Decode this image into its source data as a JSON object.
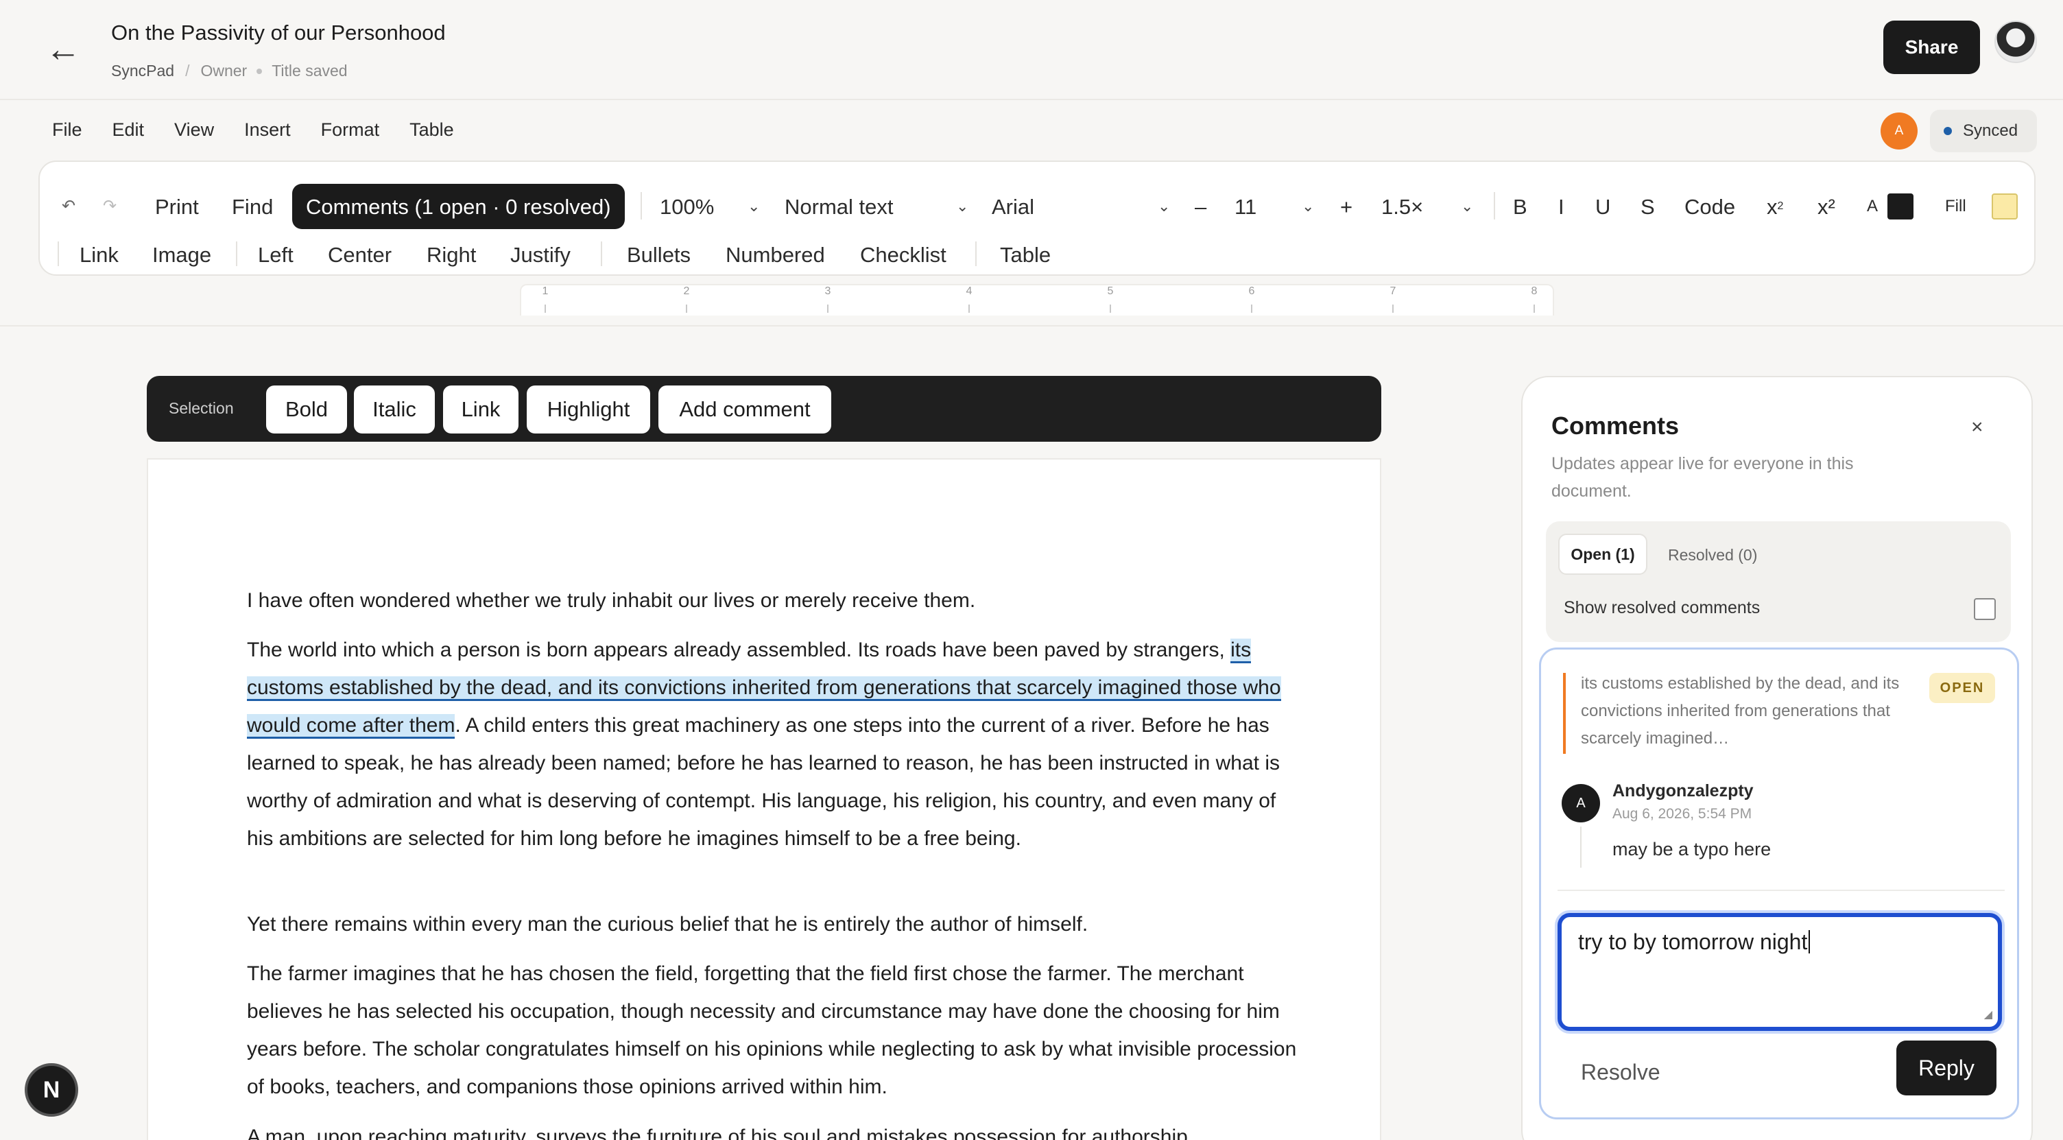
{
  "header": {
    "back_icon": "arrow-left-icon",
    "title": "On the Passivity of our Personhood",
    "app_name": "SyncPad",
    "role": "Owner",
    "status": "Title saved",
    "share_label": "Share"
  },
  "menu": [
    "File",
    "Edit",
    "View",
    "Insert",
    "Format",
    "Table"
  ],
  "presence": {
    "initial": "A",
    "color": "#f07a22"
  },
  "sync": {
    "label": "Synced",
    "dot_color": "#1e5fa8"
  },
  "toolbar": {
    "undo_icon": "undo-icon",
    "redo_icon": "redo-icon",
    "print": "Print",
    "find": "Find",
    "comments": "Comments (1 open · 0 resolved)",
    "zoom": "100%",
    "style": "Normal text",
    "font": "Arial",
    "minus": "–",
    "font_size": "11",
    "plus": "+",
    "line_spacing": "1.5×",
    "bold": "B",
    "italic": "I",
    "underline": "U",
    "strike": "S",
    "code": "Code",
    "subscript": "x",
    "subscript_sub": "2",
    "superscript": "x²",
    "text_color_label": "A",
    "text_color": "#1b1b1b",
    "fill_label": "Fill",
    "fill_color": "#fbeaa6",
    "link": "Link",
    "image": "Image",
    "left": "Left",
    "center": "Center",
    "right": "Right",
    "justify": "Justify",
    "bullets": "Bullets",
    "numbered": "Numbered",
    "checklist": "Checklist",
    "table": "Table"
  },
  "ruler": [
    "1",
    "2",
    "3",
    "4",
    "5",
    "6",
    "7",
    "8"
  ],
  "selection_bar": {
    "label": "Selection",
    "bold": "Bold",
    "italic": "Italic",
    "link": "Link",
    "highlight": "Highlight",
    "add_comment": "Add comment"
  },
  "document": {
    "p1": "I have often wondered whether we truly inhabit our lives or merely receive them.",
    "p2_before": "The world into which a person is born appears already assembled. Its roads have been paved by strangers, ",
    "p2_highlight": "its customs established by the dead, and its convictions inherited from generations that scarcely imagined those who would come after them",
    "p2_after": ". A child enters this great machinery as one steps into the current of a river. Before he has learned to speak, he has already been named; before he has learned to reason, he has been instructed in what is worthy of admiration and what is deserving of contempt. His language, his religion, his country, and even many of his ambitions are selected for him long before he imagines himself to be a free being.",
    "p3": "Yet there remains within every man the curious belief that he is entirely the author of himself.",
    "p4": "The farmer imagines that he has chosen the field, forgetting that the field first chose the farmer. The merchant believes he has selected his occupation, though necessity and circumstance may have done the choosing for him years before. The scholar congratulates himself on his opinions while neglecting to ask by what invisible procession of books, teachers, and companions those opinions arrived within him.",
    "p5": "A man, upon reaching maturity, surveys the furniture of his soul and mistakes possession for authorship."
  },
  "comments_panel": {
    "title": "Comments",
    "close": "×",
    "subtitle": "Updates appear live for everyone in this document.",
    "tab_open": "Open (1)",
    "tab_resolved": "Resolved (0)",
    "show_resolved": "Show resolved comments",
    "thread": {
      "quote": "its customs established by the dead, and its convictions inherited from generations that scarcely imagined…",
      "status": "OPEN",
      "author_initial": "A",
      "author": "Andygonzalezpty",
      "time": "Aug 6, 2026, 5:54 PM",
      "body": "may be a typo here",
      "reply_value": "try to by tomorrow night",
      "resolve": "Resolve",
      "reply": "Reply"
    }
  },
  "badge": {
    "letter": "N"
  }
}
